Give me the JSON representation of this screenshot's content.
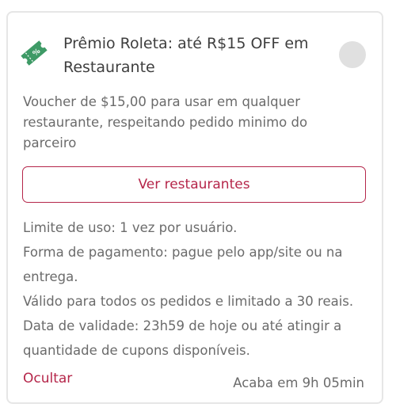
{
  "coupon": {
    "title": "Prêmio Roleta: até R$15 OFF em Restaurante",
    "icon": "ticket-percent-icon",
    "description": "Voucher de $15,00 para usar em qualquer restaurante, respeitando pedido minimo do parceiro",
    "cta_label": "Ver restaurantes",
    "rules": [
      "Limite de uso: 1 vez por usuário.",
      "Forma de pagamento: pague pelo app/site ou na entrega.",
      "Válido para todos os pedidos e limitado a 30 reais.",
      "Data de validade: 23h59 de hoje ou até atingir a quantidade de cupons disponíveis."
    ],
    "hide_label": "Ocultar",
    "expires_label": "Acaba em 9h 05min",
    "selected": false
  },
  "colors": {
    "accent": "#b5264a",
    "icon_green": "#3e9a66",
    "radio_off": "#e0e0e0",
    "text_secondary": "#6b6b6b"
  }
}
